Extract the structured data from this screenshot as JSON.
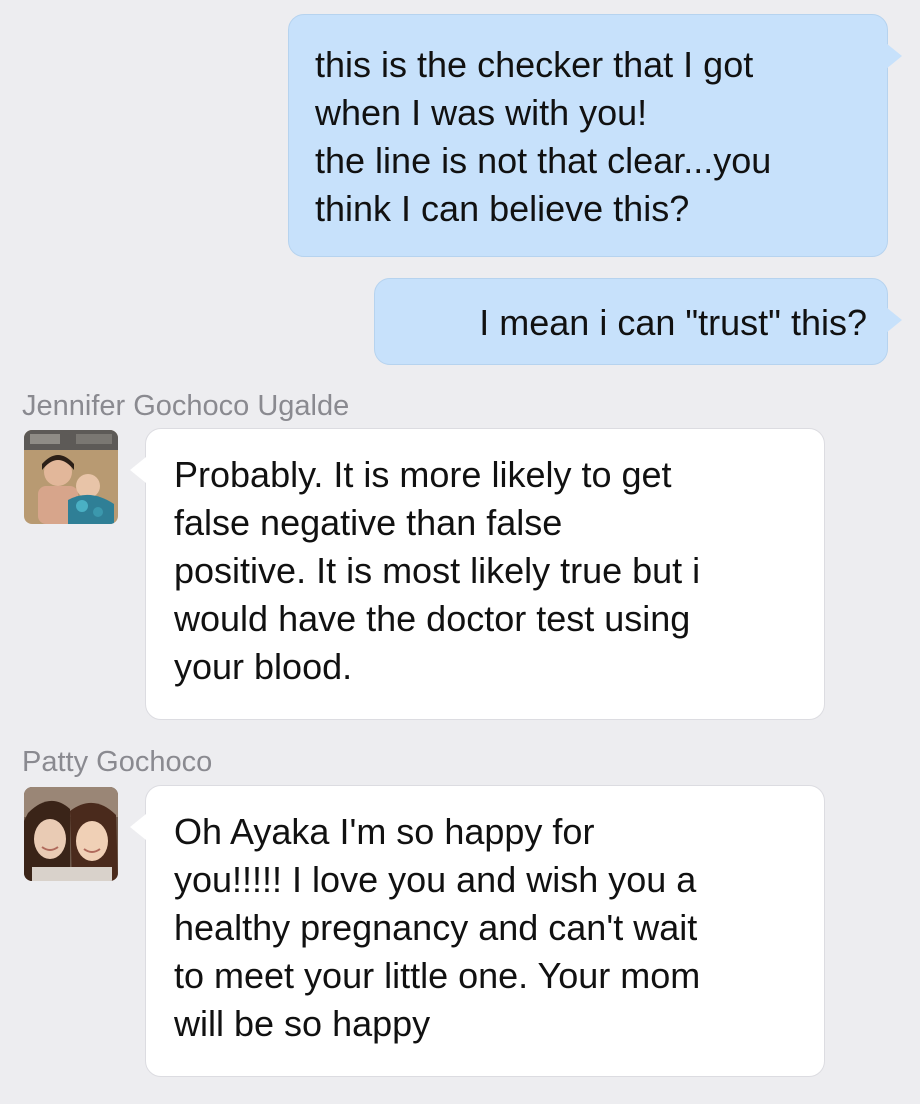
{
  "conversation": {
    "messages": [
      {
        "direction": "outgoing",
        "lines": [
          "this is the checker that I got",
          "when I was with you!",
          "the line is not that clear...you",
          "think I can believe this?"
        ]
      },
      {
        "direction": "outgoing",
        "lines": [
          "I mean i can \"trust\" this?"
        ]
      },
      {
        "direction": "incoming",
        "sender": "Jennifer Gochoco Ugalde",
        "avatar": "user-photo-avatar",
        "lines": [
          "Probably. It is more likely to get",
          "false negative than false",
          "positive. It is most likely true but i",
          "would have the doctor test using",
          "your blood."
        ]
      },
      {
        "direction": "incoming",
        "sender": "Patty Gochoco",
        "avatar": "user-photo-avatar",
        "lines": [
          "Oh Ayaka I'm so happy for",
          "you!!!!! I love you and wish you a",
          "healthy pregnancy and can't wait",
          "to meet your little one. Your mom",
          "will be so happy"
        ]
      }
    ]
  },
  "colors": {
    "background": "#ededf0",
    "outgoing_bubble": "#c7e1fb",
    "incoming_bubble": "#ffffff",
    "sender_name": "#8a8a90"
  }
}
